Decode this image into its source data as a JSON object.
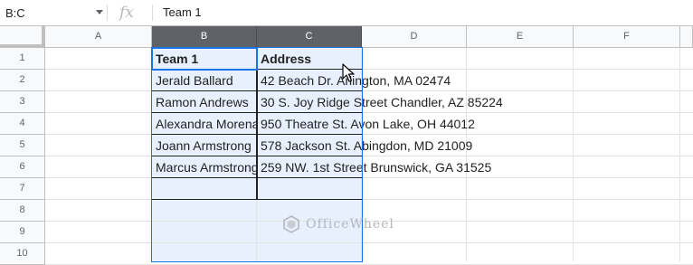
{
  "formula_bar": {
    "name_box": "B:C",
    "fx_label": "fx",
    "value": "Team 1"
  },
  "columns": [
    "A",
    "B",
    "C",
    "D",
    "E",
    "F"
  ],
  "rows": [
    "1",
    "2",
    "3",
    "4",
    "5",
    "6",
    "7",
    "8",
    "9",
    "10"
  ],
  "table": {
    "headers": [
      "Team 1",
      "Address"
    ],
    "rows": [
      [
        "Jerald Ballard",
        "42 Beach Dr. Arlington, MA 02474"
      ],
      [
        "Ramon Andrews",
        "30 S. Joy Ridge Street Chandler, AZ 85224"
      ],
      [
        "Alexandra Morena",
        "950 Theatre St. Avon Lake, OH 44012"
      ],
      [
        "Joann Armstrong",
        "578 Jackson St. Abingdon, MD 21009"
      ],
      [
        "Marcus Armstrong",
        "259 NW. 1st Street Brunswick, GA 31525"
      ]
    ]
  },
  "selection": "B:C",
  "watermark": "OfficeWheel",
  "colors": {
    "selected_header": "#5f6368",
    "selection_fill": "#e8f0fe",
    "selection_border": "#1a73e8"
  }
}
